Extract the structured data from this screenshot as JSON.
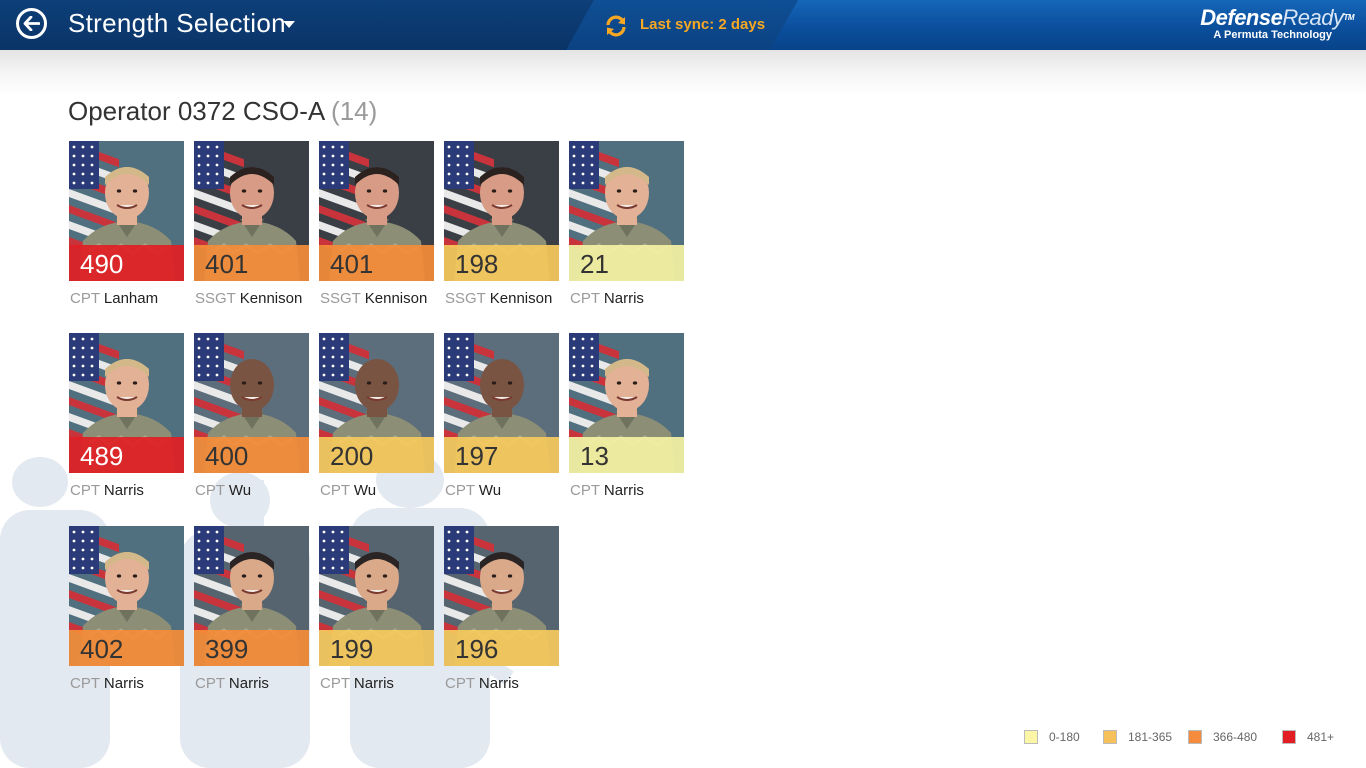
{
  "header": {
    "title": "Strength Selection",
    "sync_label": "Last sync: 2 days",
    "brand_name_bold": "Defense",
    "brand_name_light": "Ready",
    "brand_tm": "TM",
    "brand_sub": "A Permuta Technology"
  },
  "group": {
    "name": "Operator 0372 CSO-A",
    "count": "(14)"
  },
  "tiles": [
    {
      "score": "490",
      "rank": "CPT",
      "name": "Lanham",
      "level": "red",
      "person": "blond"
    },
    {
      "score": "401",
      "rank": "SSGT",
      "name": "Kennison",
      "level": "orange",
      "person": "darkhair"
    },
    {
      "score": "401",
      "rank": "SSGT",
      "name": "Kennison",
      "level": "orange",
      "person": "darkhair"
    },
    {
      "score": "198",
      "rank": "SSGT",
      "name": "Kennison",
      "level": "lightorange",
      "person": "darkhair"
    },
    {
      "score": "21",
      "rank": "CPT",
      "name": "Narris",
      "level": "yellow",
      "person": "blond"
    },
    {
      "score": "489",
      "rank": "CPT",
      "name": "Narris",
      "level": "red",
      "person": "blond"
    },
    {
      "score": "400",
      "rank": "CPT",
      "name": "Wu",
      "level": "orange",
      "person": "bald"
    },
    {
      "score": "200",
      "rank": "CPT",
      "name": "Wu",
      "level": "lightorange",
      "person": "bald"
    },
    {
      "score": "197",
      "rank": "CPT",
      "name": "Wu",
      "level": "lightorange",
      "person": "bald"
    },
    {
      "score": "13",
      "rank": "CPT",
      "name": "Narris",
      "level": "yellow",
      "person": "blond"
    },
    {
      "score": "402",
      "rank": "CPT",
      "name": "Narris",
      "level": "orange",
      "person": "blond"
    },
    {
      "score": "399",
      "rank": "CPT",
      "name": "Narris",
      "level": "orange",
      "person": "asian"
    },
    {
      "score": "199",
      "rank": "CPT",
      "name": "Narris",
      "level": "lightorange",
      "person": "asian"
    },
    {
      "score": "196",
      "rank": "CPT",
      "name": "Narris",
      "level": "lightorange",
      "person": "asian"
    }
  ],
  "legend": [
    {
      "label": "0-180",
      "color": "#fbf6a6"
    },
    {
      "label": "181-365",
      "color": "#f6c15a"
    },
    {
      "label": "366-480",
      "color": "#f58b3c"
    },
    {
      "label": "481+",
      "color": "#e21e24"
    }
  ],
  "colors": {
    "header_blue": "#0b4f9c",
    "sync_orange": "#f7a823",
    "red": "#e21e24",
    "orange": "#f58b3c",
    "lightorange": "#f6c15a",
    "yellow": "#f3f1a3"
  }
}
